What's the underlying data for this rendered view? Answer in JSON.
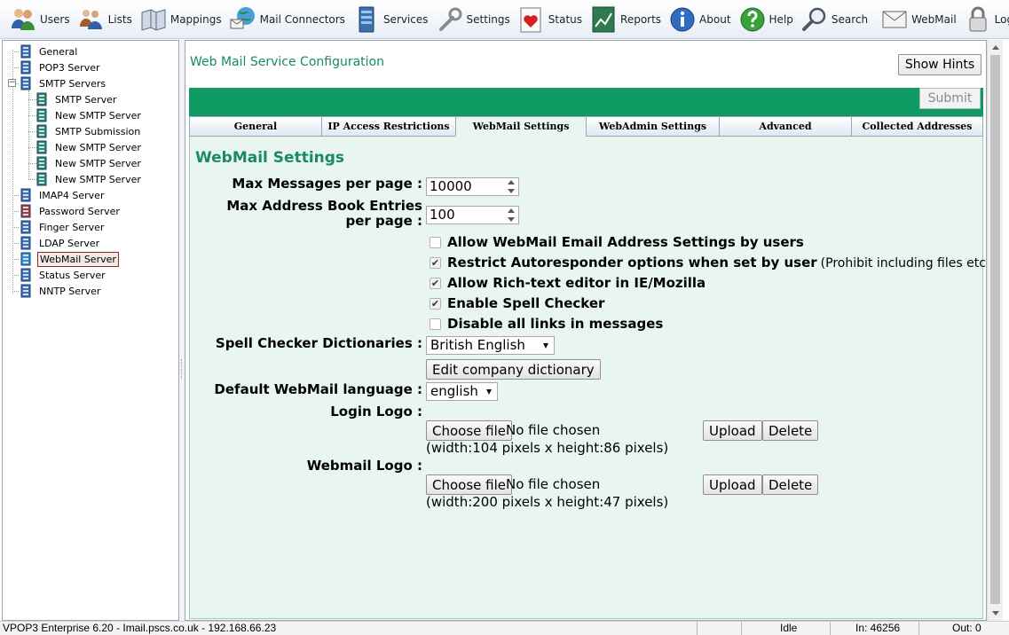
{
  "toolbar": {
    "items": [
      {
        "label": "Users",
        "icon": "users-icon"
      },
      {
        "label": "Lists",
        "icon": "lists-icon"
      },
      {
        "label": "Mappings",
        "icon": "mappings-icon"
      },
      {
        "label": "Mail Connectors",
        "icon": "mail-connectors-icon"
      },
      {
        "label": "Services",
        "icon": "services-icon"
      },
      {
        "label": "Settings",
        "icon": "settings-icon"
      },
      {
        "label": "Status",
        "icon": "status-icon"
      },
      {
        "label": "Reports",
        "icon": "reports-icon"
      },
      {
        "label": "About",
        "icon": "about-icon"
      },
      {
        "label": "Help",
        "icon": "help-icon"
      },
      {
        "label": "Search",
        "icon": "search-icon"
      },
      {
        "label": "WebMail",
        "icon": "webmail-icon"
      },
      {
        "label": "Logout",
        "icon": "logout-icon"
      }
    ]
  },
  "tree": {
    "items": [
      {
        "label": "General"
      },
      {
        "label": "POP3 Server"
      },
      {
        "label": "SMTP Servers",
        "expander": "−"
      },
      {
        "label": "SMTP Server"
      },
      {
        "label": "New SMTP Server"
      },
      {
        "label": "SMTP Submission"
      },
      {
        "label": "New SMTP Server"
      },
      {
        "label": "New SMTP Server"
      },
      {
        "label": "New SMTP Server"
      },
      {
        "label": "IMAP4 Server"
      },
      {
        "label": "Password Server"
      },
      {
        "label": "Finger Server"
      },
      {
        "label": "LDAP Server"
      },
      {
        "label": "WebMail Server",
        "selected": true
      },
      {
        "label": "Status Server"
      },
      {
        "label": "NNTP Server"
      }
    ]
  },
  "main": {
    "title": "Web Mail Service Configuration",
    "show_hints_label": "Show Hints",
    "submit_label": "Submit",
    "tabs": [
      {
        "label": "General"
      },
      {
        "label": "IP Access Restrictions"
      },
      {
        "label": "WebMail Settings",
        "active": true
      },
      {
        "label": "WebAdmin Settings"
      },
      {
        "label": "Advanced"
      },
      {
        "label": "Collected Addresses"
      }
    ],
    "section_heading": "WebMail Settings",
    "fields": {
      "max_messages_label": "Max Messages per page :",
      "max_messages_value": "10000",
      "max_address_label": "Max Address Book Entries per page :",
      "max_address_value": "100"
    },
    "checkboxes": [
      {
        "label": "Allow WebMail Email Address Settings by users",
        "checked": false,
        "note": ""
      },
      {
        "label": "Restrict Autoresponder options when set by user",
        "checked": true,
        "note": "(Prohibit including files etc)"
      },
      {
        "label": "Allow Rich-text editor in IE/Mozilla",
        "checked": true,
        "note": ""
      },
      {
        "label": "Enable Spell Checker",
        "checked": true,
        "note": ""
      },
      {
        "label": "Disable all links in messages",
        "checked": false,
        "note": ""
      }
    ],
    "spell_dict_label": "Spell Checker Dictionaries :",
    "spell_dict_value": "British English",
    "edit_dictionary_label": "Edit company dictionary",
    "language_label": "Default WebMail language :",
    "language_value": "english",
    "login_logo": {
      "label": "Login Logo :",
      "choose_file_label": "Choose file",
      "no_file_text": "No file chosen",
      "upload_label": "Upload",
      "delete_label": "Delete",
      "size_hint": "(width:104 pixels x height:86 pixels)"
    },
    "webmail_logo": {
      "label": "Webmail Logo :",
      "choose_file_label": "Choose file",
      "no_file_text": "No file chosen",
      "upload_label": "Upload",
      "delete_label": "Delete",
      "size_hint": "(width:200 pixels x height:47 pixels)"
    }
  },
  "status_bar": {
    "app_info": "VPOP3 Enterprise 6.20 - Imail.pscs.co.uk - 192.168.66.23",
    "state": "Idle",
    "in_count": "In: 46256",
    "out_count": "Out: 0"
  },
  "colors": {
    "accent_green": "#0f9a64",
    "heading_green": "#198a62",
    "panel_bg": "#e9f6ef"
  }
}
